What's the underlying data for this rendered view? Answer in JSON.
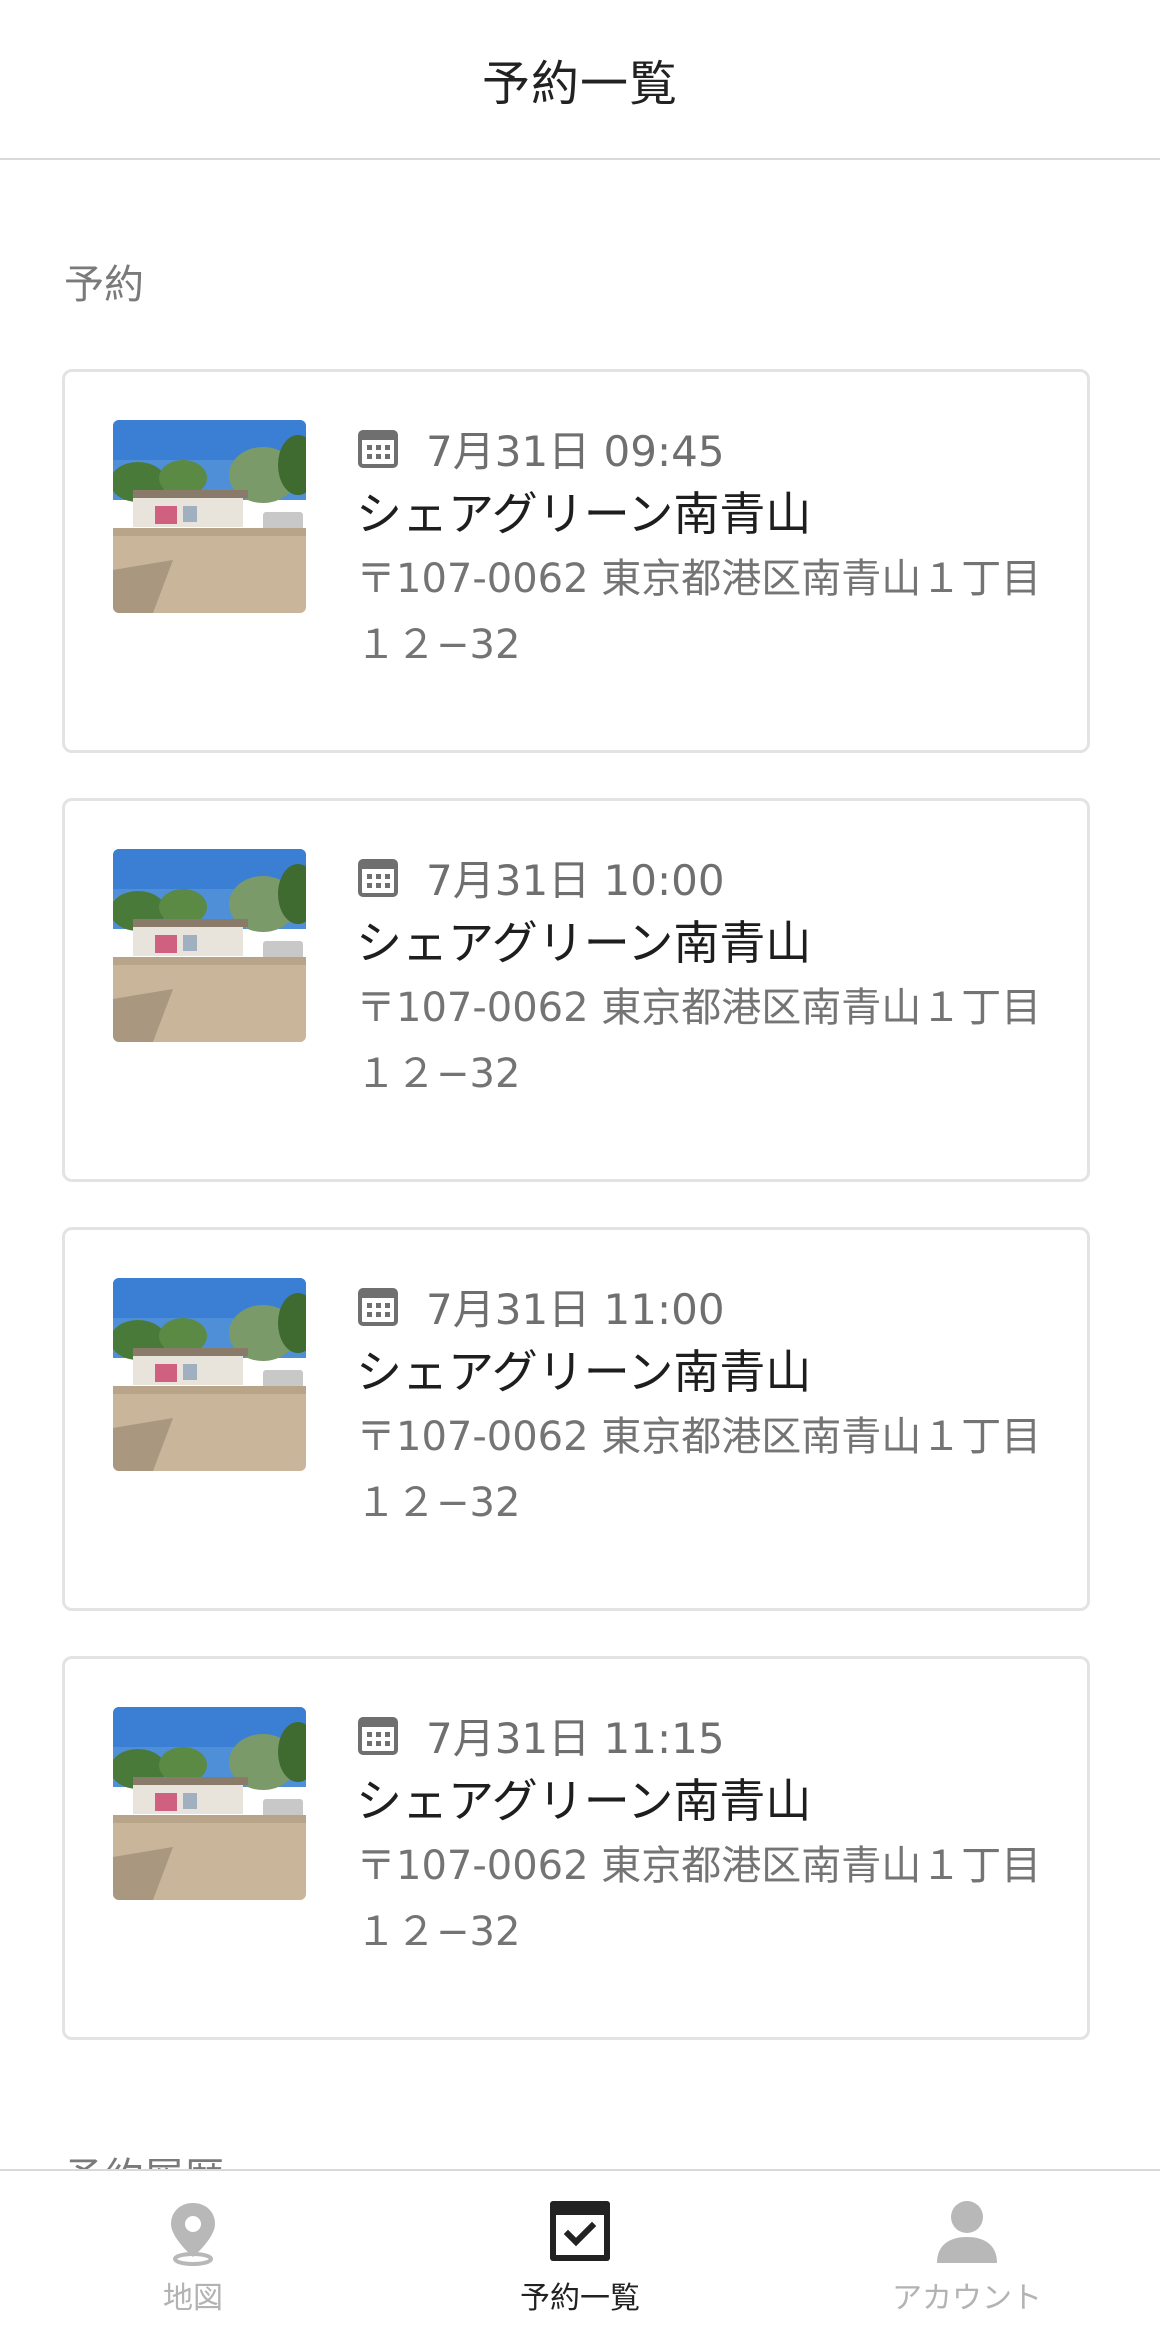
{
  "header": {
    "title": "予約一覧"
  },
  "sections": {
    "reservations_title": "予約",
    "history_title": "予約履歴"
  },
  "reservations": [
    {
      "datetime": "7月31日 09:45",
      "name": "シェアグリーン南青山",
      "address": "〒107-0062 東京都港区南青山１丁目１２−32"
    },
    {
      "datetime": "7月31日 10:00",
      "name": "シェアグリーン南青山",
      "address": "〒107-0062 東京都港区南青山１丁目１２−32"
    },
    {
      "datetime": "7月31日 11:00",
      "name": "シェアグリーン南青山",
      "address": "〒107-0062 東京都港区南青山１丁目１２−32"
    },
    {
      "datetime": "7月31日 11:15",
      "name": "シェアグリーン南青山",
      "address": "〒107-0062 東京都港区南青山１丁目１２−32"
    }
  ],
  "tabbar": {
    "items": [
      {
        "label": "地図",
        "icon": "map-pin-icon",
        "active": false
      },
      {
        "label": "予約一覧",
        "icon": "calendar-check-icon",
        "active": true
      },
      {
        "label": "アカウント",
        "icon": "person-icon",
        "active": false
      }
    ]
  },
  "colors": {
    "active": "#222222",
    "inactive": "#b3b3b3",
    "secondary_text": "#747474",
    "border": "#e3e3e3"
  }
}
